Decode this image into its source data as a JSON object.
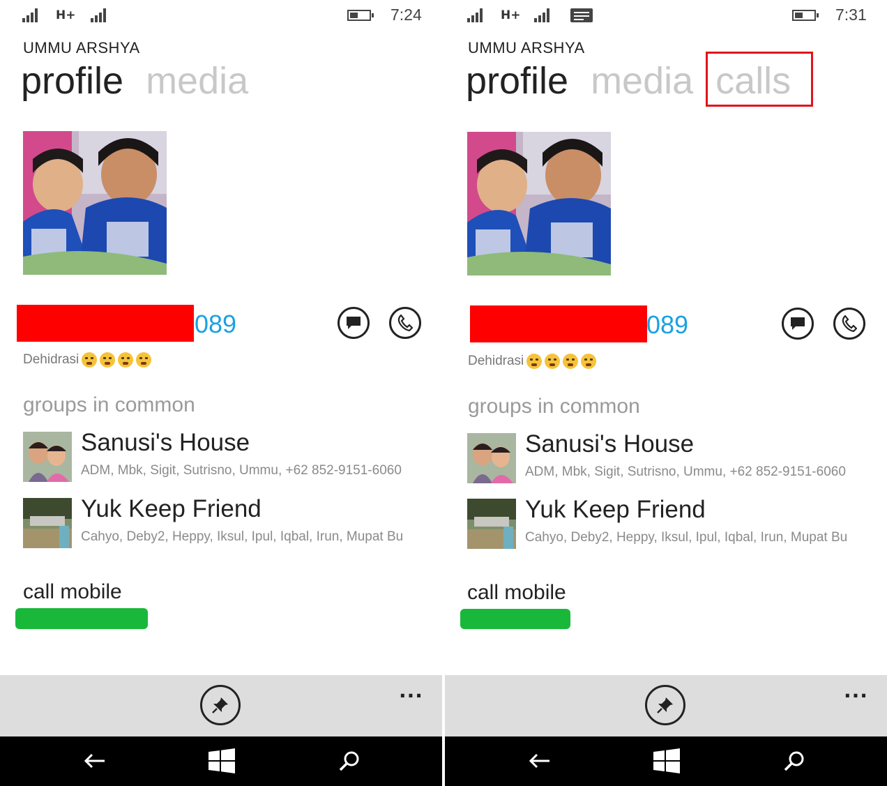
{
  "screens": [
    {
      "status": {
        "network": "H+",
        "time": "7:24",
        "battery_level": 0.35,
        "message_indicator": false
      },
      "contact_name": "UMMU ARSHYA",
      "pivots": [
        "profile",
        "media"
      ],
      "active_pivot": "profile",
      "phone_visible": "089",
      "status_text": "Dehidrasi",
      "groups_heading": "groups in common",
      "groups": [
        {
          "name": "Sanusi's House",
          "members": "ADM, Mbk, Sigit, Sutrisno, Ummu, +62 852-9151-6060"
        },
        {
          "name": "Yuk Keep Friend",
          "members": "Cahyo, Deby2, Heppy, Iksul, Ipul, Iqbal, Irun, Mupat Bu"
        }
      ],
      "call_label": "call mobile",
      "more": "..."
    },
    {
      "status": {
        "network": "H+",
        "time": "7:31",
        "battery_level": 0.35,
        "message_indicator": true
      },
      "contact_name": "UMMU ARSHYA",
      "pivots": [
        "profile",
        "media",
        "calls"
      ],
      "active_pivot": "profile",
      "highlighted_pivot": "calls",
      "phone_visible": "089",
      "status_text": "Dehidrasi",
      "groups_heading": "groups in common",
      "groups": [
        {
          "name": "Sanusi's House",
          "members": "ADM, Mbk, Sigit, Sutrisno, Ummu, +62 852-9151-6060"
        },
        {
          "name": "Yuk Keep Friend",
          "members": "Cahyo, Deby2, Heppy, Iksul, Ipul, Iqbal, Irun, Mupat Bu"
        }
      ],
      "call_label": "call mobile",
      "more": "..."
    }
  ],
  "colors": {
    "accent": "#1ba1e2",
    "redaction_red": "#ff0000",
    "redaction_green": "#19b83b",
    "highlight": "#e0141c",
    "appbar": "#dddddd"
  }
}
